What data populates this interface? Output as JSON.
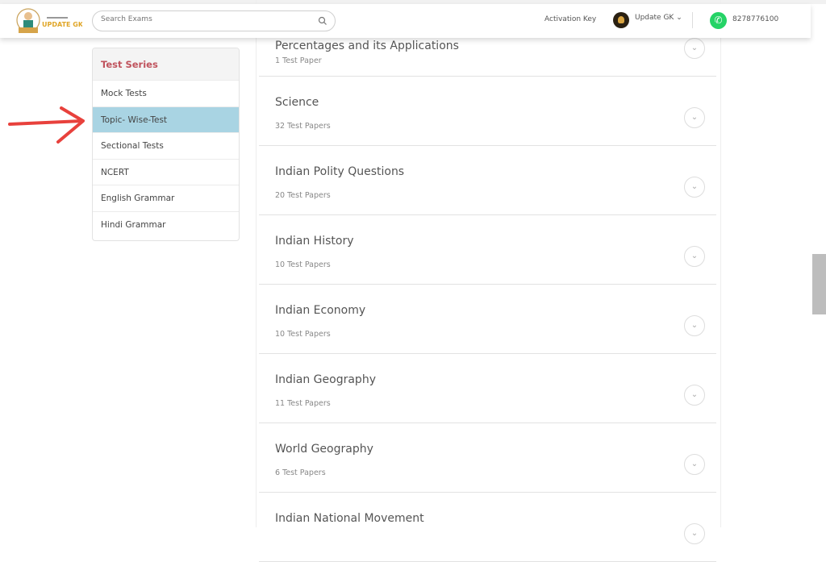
{
  "header": {
    "logo_text": "UPDATE GK",
    "search_placeholder": "Search Exams",
    "activation_key": "Activation Key",
    "user_name": "Update GK ⌄",
    "phone": "8278776100"
  },
  "sidebar": {
    "title": "Test Series",
    "items": [
      {
        "label": "Mock Tests"
      },
      {
        "label": "Topic- Wise-Test",
        "active": true
      },
      {
        "label": "Sectional Tests"
      },
      {
        "label": "NCERT"
      },
      {
        "label": "English Grammar"
      },
      {
        "label": "Hindi Grammar"
      }
    ]
  },
  "topics": [
    {
      "title": "Percentages and its Applications",
      "count": "1 Test Paper"
    },
    {
      "title": "Science",
      "count": "32 Test Papers"
    },
    {
      "title": "Indian Polity Questions",
      "count": "20 Test Papers"
    },
    {
      "title": "Indian History",
      "count": "10 Test Papers"
    },
    {
      "title": "Indian Economy",
      "count": "10 Test Papers"
    },
    {
      "title": "Indian Geography",
      "count": "11 Test Papers"
    },
    {
      "title": "World Geography",
      "count": "6 Test Papers"
    },
    {
      "title": "Indian National Movement",
      "count": ""
    }
  ],
  "colors": {
    "accent_red": "#c0535d",
    "active_bg": "#a9d4e3",
    "whatsapp": "#25d366",
    "annotation_arrow": "#e8413c"
  }
}
